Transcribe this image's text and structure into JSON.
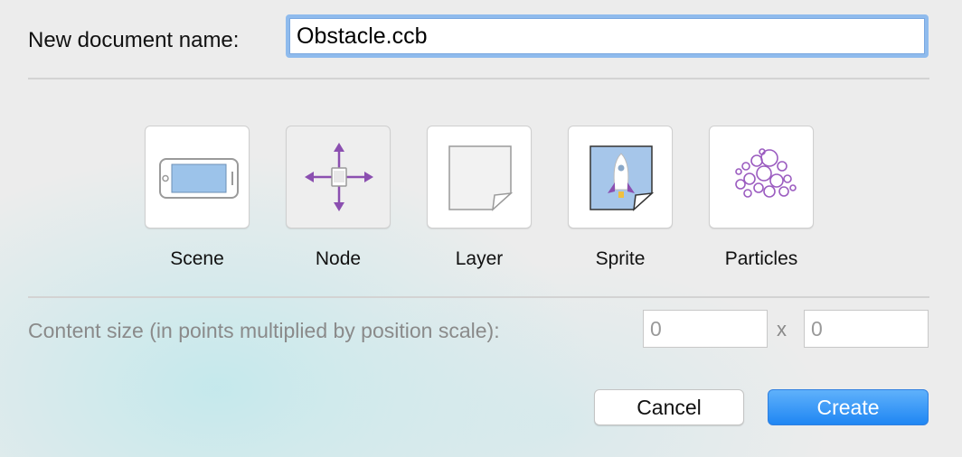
{
  "dialog": {
    "name_label": "New document name:",
    "name_value": "Obstacle.ccb"
  },
  "types": [
    {
      "label": "Scene",
      "icon": "scene-icon",
      "selected": false
    },
    {
      "label": "Node",
      "icon": "node-icon",
      "selected": true
    },
    {
      "label": "Layer",
      "icon": "layer-icon",
      "selected": false
    },
    {
      "label": "Sprite",
      "icon": "sprite-icon",
      "selected": false
    },
    {
      "label": "Particles",
      "icon": "particles-icon",
      "selected": false
    }
  ],
  "content_size": {
    "label": "Content size (in points multiplied by position scale):",
    "width_value": "0",
    "separator": "x",
    "height_value": "0"
  },
  "buttons": {
    "cancel": "Cancel",
    "create": "Create"
  },
  "colors": {
    "accent_blue": "#1f86f3",
    "icon_purple": "#8b4fb0",
    "icon_blue": "#9cc3ea"
  }
}
